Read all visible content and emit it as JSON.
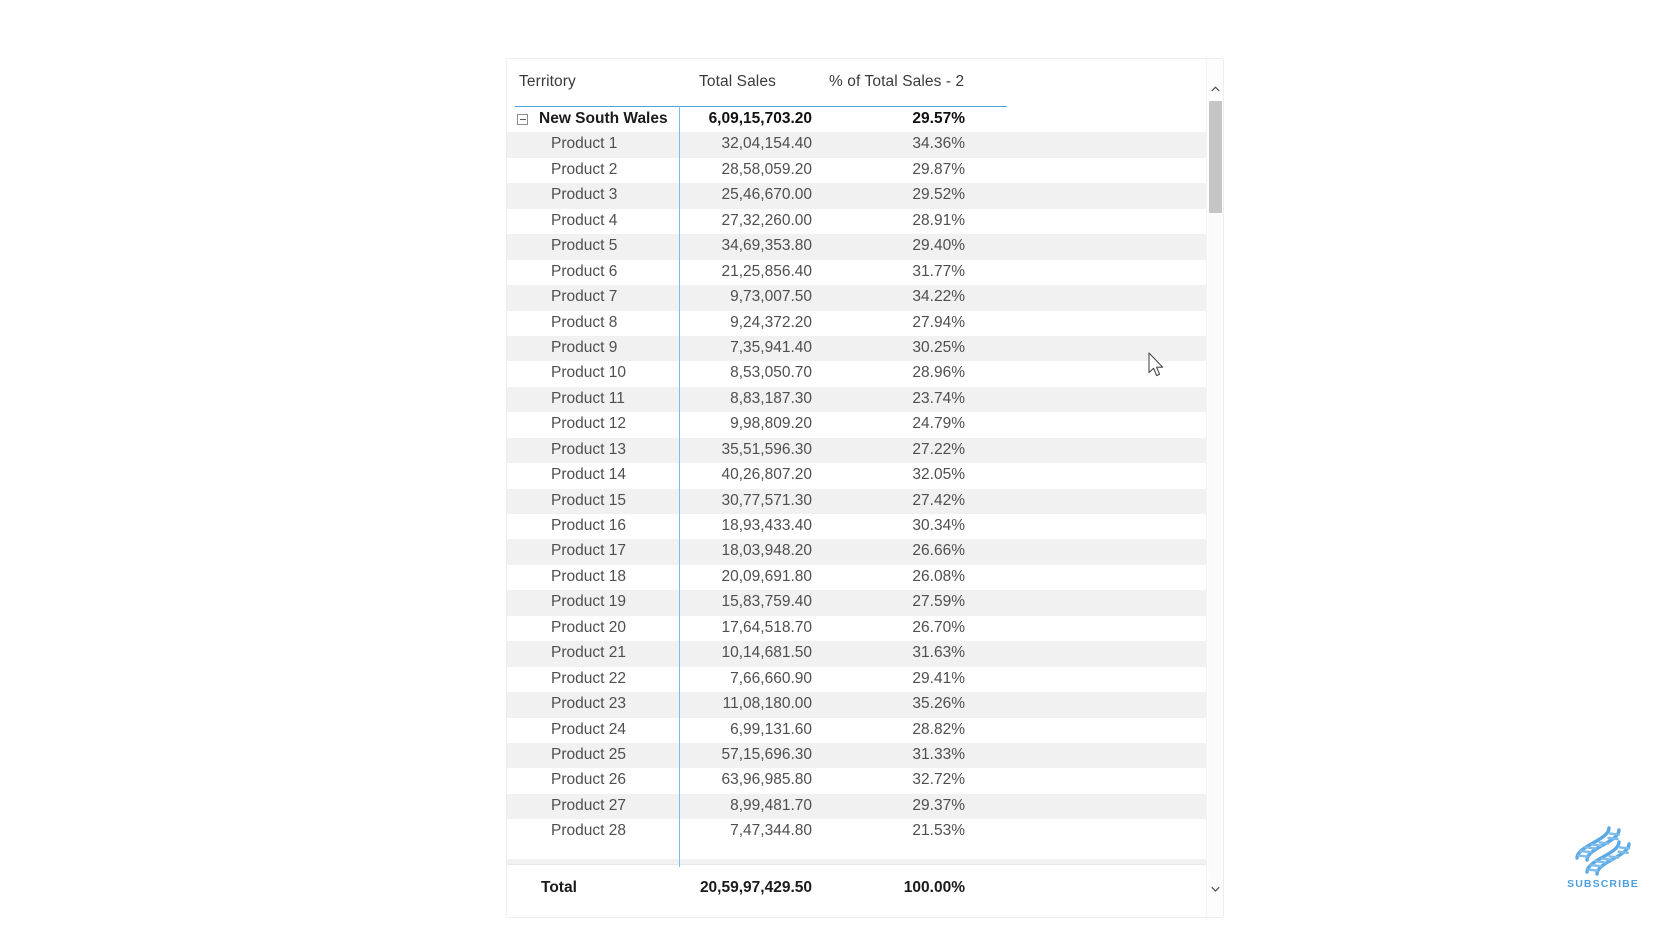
{
  "visual": {
    "type": "matrix-table",
    "accent_color": "#4aa3df",
    "row_shade_color": "#f1f1f1",
    "columns": [
      {
        "key": "territory",
        "label": "Territory",
        "align": "left"
      },
      {
        "key": "total_sales",
        "label": "Total Sales",
        "align": "right"
      },
      {
        "key": "pct_of_total",
        "label": "% of Total Sales - 2",
        "align": "right"
      }
    ],
    "group_row": {
      "territory": "New South Wales",
      "total_sales": "6,09,15,703.20",
      "pct_of_total": "29.57%",
      "expander_icon": "collapse-minus-box-icon",
      "expanded": true
    },
    "rows": [
      {
        "territory": "Product 1",
        "total_sales": "32,04,154.40",
        "pct_of_total": "34.36%"
      },
      {
        "territory": "Product 2",
        "total_sales": "28,58,059.20",
        "pct_of_total": "29.87%"
      },
      {
        "territory": "Product 3",
        "total_sales": "25,46,670.00",
        "pct_of_total": "29.52%"
      },
      {
        "territory": "Product 4",
        "total_sales": "27,32,260.00",
        "pct_of_total": "28.91%"
      },
      {
        "territory": "Product 5",
        "total_sales": "34,69,353.80",
        "pct_of_total": "29.40%"
      },
      {
        "territory": "Product 6",
        "total_sales": "21,25,856.40",
        "pct_of_total": "31.77%"
      },
      {
        "territory": "Product 7",
        "total_sales": "9,73,007.50",
        "pct_of_total": "34.22%"
      },
      {
        "territory": "Product 8",
        "total_sales": "9,24,372.20",
        "pct_of_total": "27.94%"
      },
      {
        "territory": "Product 9",
        "total_sales": "7,35,941.40",
        "pct_of_total": "30.25%"
      },
      {
        "territory": "Product 10",
        "total_sales": "8,53,050.70",
        "pct_of_total": "28.96%"
      },
      {
        "territory": "Product 11",
        "total_sales": "8,83,187.30",
        "pct_of_total": "23.74%"
      },
      {
        "territory": "Product 12",
        "total_sales": "9,98,809.20",
        "pct_of_total": "24.79%"
      },
      {
        "territory": "Product 13",
        "total_sales": "35,51,596.30",
        "pct_of_total": "27.22%"
      },
      {
        "territory": "Product 14",
        "total_sales": "40,26,807.20",
        "pct_of_total": "32.05%"
      },
      {
        "territory": "Product 15",
        "total_sales": "30,77,571.30",
        "pct_of_total": "27.42%"
      },
      {
        "territory": "Product 16",
        "total_sales": "18,93,433.40",
        "pct_of_total": "30.34%"
      },
      {
        "territory": "Product 17",
        "total_sales": "18,03,948.20",
        "pct_of_total": "26.66%"
      },
      {
        "territory": "Product 18",
        "total_sales": "20,09,691.80",
        "pct_of_total": "26.08%"
      },
      {
        "territory": "Product 19",
        "total_sales": "15,83,759.40",
        "pct_of_total": "27.59%"
      },
      {
        "territory": "Product 20",
        "total_sales": "17,64,518.70",
        "pct_of_total": "26.70%"
      },
      {
        "territory": "Product 21",
        "total_sales": "10,14,681.50",
        "pct_of_total": "31.63%"
      },
      {
        "territory": "Product 22",
        "total_sales": "7,66,660.90",
        "pct_of_total": "29.41%"
      },
      {
        "territory": "Product 23",
        "total_sales": "11,08,180.00",
        "pct_of_total": "35.26%"
      },
      {
        "territory": "Product 24",
        "total_sales": "6,99,131.60",
        "pct_of_total": "28.82%"
      },
      {
        "territory": "Product 25",
        "total_sales": "57,15,696.30",
        "pct_of_total": "31.33%"
      },
      {
        "territory": "Product 26",
        "total_sales": "63,96,985.80",
        "pct_of_total": "32.72%"
      },
      {
        "territory": "Product 27",
        "total_sales": "8,99,481.70",
        "pct_of_total": "29.37%"
      },
      {
        "territory": "Product 28",
        "total_sales": "7,47,344.80",
        "pct_of_total": "21.53%"
      }
    ],
    "total_row": {
      "territory": "Total",
      "total_sales": "20,59,97,429.50",
      "pct_of_total": "100.00%"
    },
    "scrollbar": {
      "up_arrow": "chevron-up-icon",
      "down_arrow": "chevron-down-icon"
    }
  },
  "watermark": {
    "label": "SUBSCRIBE",
    "icon": "dna-helix-icon",
    "color": "#4f9fe0"
  },
  "chart_data": {
    "type": "table",
    "title": "New South Wales sales by product",
    "columns": [
      "Territory",
      "Total Sales",
      "% of Total Sales - 2"
    ],
    "categories": [
      "New South Wales",
      "Product 1",
      "Product 2",
      "Product 3",
      "Product 4",
      "Product 5",
      "Product 6",
      "Product 7",
      "Product 8",
      "Product 9",
      "Product 10",
      "Product 11",
      "Product 12",
      "Product 13",
      "Product 14",
      "Product 15",
      "Product 16",
      "Product 17",
      "Product 18",
      "Product 19",
      "Product 20",
      "Product 21",
      "Product 22",
      "Product 23",
      "Product 24",
      "Product 25",
      "Product 26",
      "Product 27",
      "Product 28",
      "Total"
    ],
    "series": [
      {
        "name": "Total Sales",
        "values": [
          60915703.2,
          3204154.4,
          2858059.2,
          2546670.0,
          2732260.0,
          3469353.8,
          2125856.4,
          973007.5,
          924372.2,
          735941.4,
          853050.7,
          883187.3,
          998809.2,
          3551596.3,
          4026807.2,
          3077571.3,
          1893433.4,
          1803948.2,
          2009691.8,
          1583759.4,
          1764518.7,
          1014681.5,
          766660.9,
          1108180.0,
          699131.6,
          5715696.3,
          6396985.8,
          899481.7,
          747344.8,
          205997429.5
        ]
      },
      {
        "name": "% of Total Sales - 2",
        "values": [
          29.57,
          34.36,
          29.87,
          29.52,
          28.91,
          29.4,
          31.77,
          34.22,
          27.94,
          30.25,
          28.96,
          23.74,
          24.79,
          27.22,
          32.05,
          27.42,
          30.34,
          26.66,
          26.08,
          27.59,
          26.7,
          31.63,
          29.41,
          35.26,
          28.82,
          31.33,
          32.72,
          29.37,
          21.53,
          100.0
        ]
      }
    ]
  }
}
